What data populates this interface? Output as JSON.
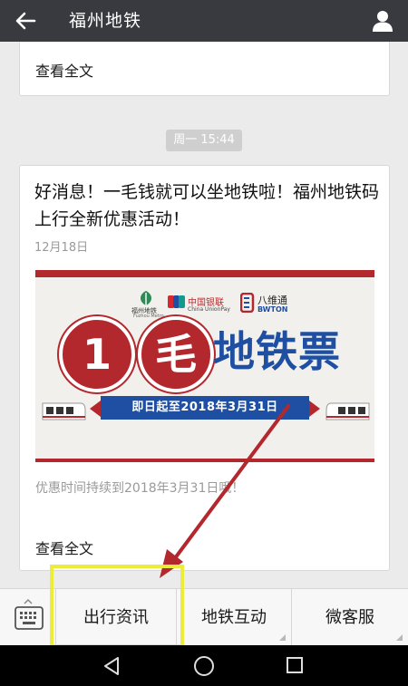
{
  "header": {
    "title": "福州地铁",
    "back_icon": "back-arrow-icon",
    "profile_icon": "user-profile-icon"
  },
  "messages": {
    "first_card": {
      "read_full": "查看全文"
    },
    "timestamp": "周一 15:44",
    "article": {
      "headline": "好消息！一毛钱就可以坐地铁啦！福州地铁码上行全新优惠活动！",
      "date": "12月18日",
      "banner": {
        "metro_logo_text": "福州地铁",
        "metro_logo_sub": "Fuzhou Metro",
        "unionpay_text": "中国银联",
        "unionpay_sub": "China UnionPay",
        "bwton_text": "八维通",
        "bwton_sub": "BWTON",
        "circle_1": "1",
        "circle_2": "毛",
        "big_title": "地铁票",
        "date_ribbon": "即日起至2018年3月31日"
      },
      "promo_time": "优惠时间持续到2018年3月31日哦！",
      "read_full": "查看全文"
    }
  },
  "menu": {
    "keyboard_icon": "keyboard-icon",
    "items": [
      {
        "label": "出行资讯"
      },
      {
        "label": "地铁互动"
      },
      {
        "label": "微客服"
      }
    ]
  },
  "colors": {
    "topbar": "#393a3f",
    "brand_red": "#b3282d",
    "brand_blue": "#1e4fa2",
    "highlight": "#ecec3a",
    "arrow": "#b3282d"
  }
}
